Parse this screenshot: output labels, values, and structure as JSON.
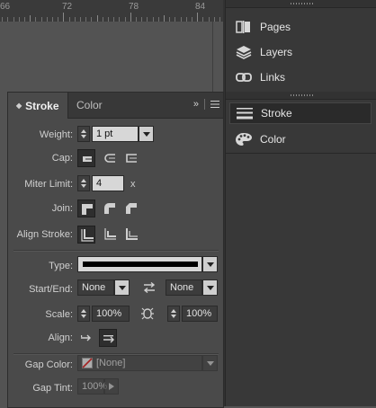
{
  "ruler": {
    "labels": [
      "66",
      "72",
      "78",
      "84"
    ]
  },
  "dock": {
    "items": [
      {
        "label": "Pages",
        "icon": "pages-icon"
      },
      {
        "label": "Layers",
        "icon": "layers-icon"
      },
      {
        "label": "Links",
        "icon": "links-icon"
      },
      {
        "label": "Stroke",
        "icon": "stroke-icon",
        "active": true
      },
      {
        "label": "Color",
        "icon": "color-palette-icon"
      }
    ]
  },
  "panel": {
    "tabs": [
      {
        "label": "Stroke",
        "active": true
      },
      {
        "label": "Color",
        "active": false
      }
    ],
    "collapse_glyph": "»",
    "weight": {
      "label": "Weight:",
      "value": "1 pt"
    },
    "cap": {
      "label": "Cap:",
      "options": [
        "butt-cap",
        "round-cap",
        "projecting-cap"
      ],
      "selected": 0
    },
    "miter": {
      "label": "Miter Limit:",
      "value": "4",
      "suffix": "x"
    },
    "join": {
      "label": "Join:",
      "options": [
        "miter-join",
        "round-join",
        "bevel-join"
      ],
      "selected": 0
    },
    "align_stroke": {
      "label": "Align Stroke:",
      "options": [
        "center",
        "inside",
        "outside"
      ],
      "selected": 0
    },
    "type": {
      "label": "Type:",
      "value_color": "#000000"
    },
    "start_end": {
      "label": "Start/End:",
      "start": "None",
      "end": "None"
    },
    "scale": {
      "label": "Scale:",
      "start": "100%",
      "end": "100%"
    },
    "align": {
      "label": "Align:",
      "selected": 1
    },
    "gap_color": {
      "label": "Gap Color:",
      "value": "[None]"
    },
    "gap_tint": {
      "label": "Gap Tint:",
      "value": "100%"
    }
  },
  "colors": {
    "panel_bg": "#4a4a4a",
    "dock_bg": "#383838",
    "canvas": "#535353"
  }
}
